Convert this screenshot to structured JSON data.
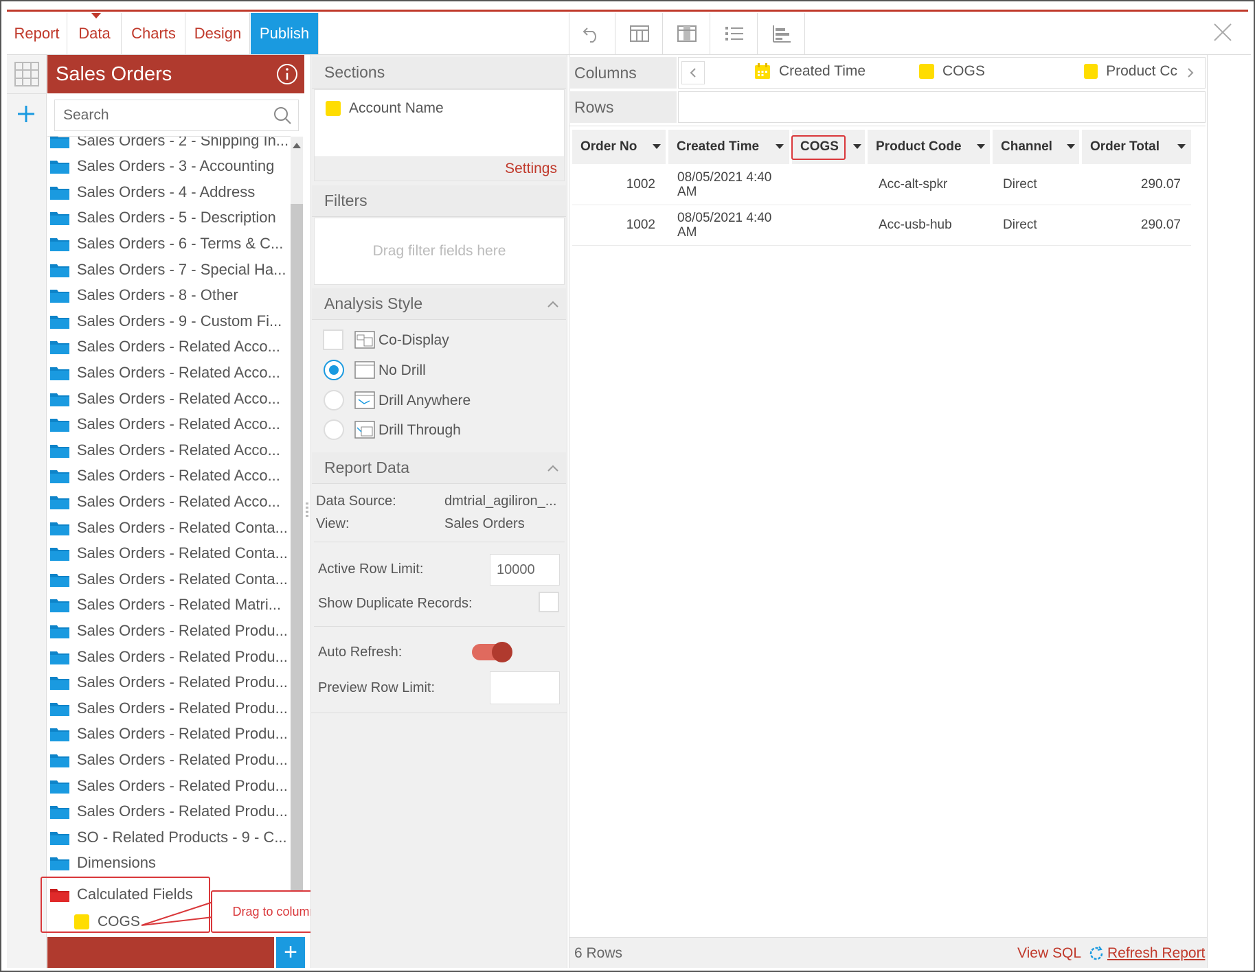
{
  "tabs": [
    {
      "label": "Report",
      "active": false
    },
    {
      "label": "Data",
      "active": false
    },
    {
      "label": "Charts",
      "active": false
    },
    {
      "label": "Design",
      "active": false
    },
    {
      "label": "Publish",
      "active": true
    }
  ],
  "toolbar_icons": [
    "undo-icon",
    "columns-icon",
    "table-layout-icon",
    "list-icon",
    "bar-list-icon"
  ],
  "left": {
    "title": "Sales Orders",
    "search_placeholder": "Search",
    "tree": [
      "Sales Orders - 2 - Shipping In...",
      "Sales Orders - 3 - Accounting",
      "Sales Orders - 4 - Address",
      "Sales Orders - 5 - Description",
      "Sales Orders - 6 - Terms & C...",
      "Sales Orders - 7 - Special Ha...",
      "Sales Orders - 8 - Other",
      "Sales Orders - 9 - Custom Fi...",
      "Sales Orders - Related Acco...",
      "Sales Orders - Related Acco...",
      "Sales Orders - Related Acco...",
      "Sales Orders - Related Acco...",
      "Sales Orders - Related Acco...",
      "Sales Orders - Related Acco...",
      "Sales Orders - Related Acco...",
      "Sales Orders - Related Conta...",
      "Sales Orders - Related Conta...",
      "Sales Orders - Related Conta...",
      "Sales Orders - Related Matri...",
      "Sales Orders - Related Produ...",
      "Sales Orders - Related Produ...",
      "Sales Orders - Related Produ...",
      "Sales Orders - Related Produ...",
      "Sales Orders - Related Produ...",
      "Sales Orders - Related Produ...",
      "Sales Orders - Related Produ...",
      "Sales Orders - Related Produ...",
      "SO - Related Products - 9 - C...",
      "Dimensions"
    ],
    "calc_folder": "Calculated Fields",
    "calc_field": "COGS",
    "callout": "Drag to column section"
  },
  "middle": {
    "sections_title": "Sections",
    "section_field": "Account Name",
    "settings_link": "Settings",
    "filters_title": "Filters",
    "filters_placeholder": "Drag filter fields here",
    "analysis_title": "Analysis Style",
    "analysis_options": [
      {
        "label": "Co-Display",
        "type": "checkbox",
        "checked": false
      },
      {
        "label": "No Drill",
        "type": "radio",
        "checked": true
      },
      {
        "label": "Drill Anywhere",
        "type": "radio",
        "checked": false
      },
      {
        "label": "Drill Through",
        "type": "radio",
        "checked": false
      }
    ],
    "report_data_title": "Report Data",
    "data_source_label": "Data Source:",
    "data_source_value": "dmtrial_agiliron_...",
    "view_label": "View:",
    "view_value": "Sales Orders",
    "active_row_limit_label": "Active Row Limit:",
    "active_row_limit_value": "10000",
    "show_duplicates_label": "Show Duplicate Records:",
    "auto_refresh_label": "Auto Refresh:",
    "auto_refresh_on": true,
    "preview_row_limit_label": "Preview Row Limit:",
    "preview_row_limit_value": ""
  },
  "right": {
    "columns_label": "Columns",
    "rows_label": "Rows",
    "column_chips": [
      "Created Time",
      "COGS",
      "Product Cc"
    ],
    "headers": [
      "Order No",
      "Created Time",
      "COGS",
      "Product Code",
      "Channel",
      "Order Total"
    ],
    "rows": [
      {
        "order_no": "1002",
        "created_line1": "08/05/2021 4:40",
        "created_line2": "AM",
        "cogs": "",
        "product_code": "Acc-alt-spkr",
        "channel": "Direct",
        "order_total": "290.07"
      },
      {
        "order_no": "1002",
        "created_line1": "08/05/2021 4:40",
        "created_line2": "AM",
        "cogs": "",
        "product_code": "Acc-usb-hub",
        "channel": "Direct",
        "order_total": "290.07"
      }
    ],
    "row_count": "6 Rows",
    "view_sql": "View SQL",
    "refresh_report": "Refresh Report"
  },
  "colors": {
    "brand_red": "#b03a2e",
    "accent_blue": "#1a9ae0",
    "chip_yellow": "#ffdd00",
    "folder_blue": "#1a9ae0",
    "callout_red": "#d9373a"
  }
}
